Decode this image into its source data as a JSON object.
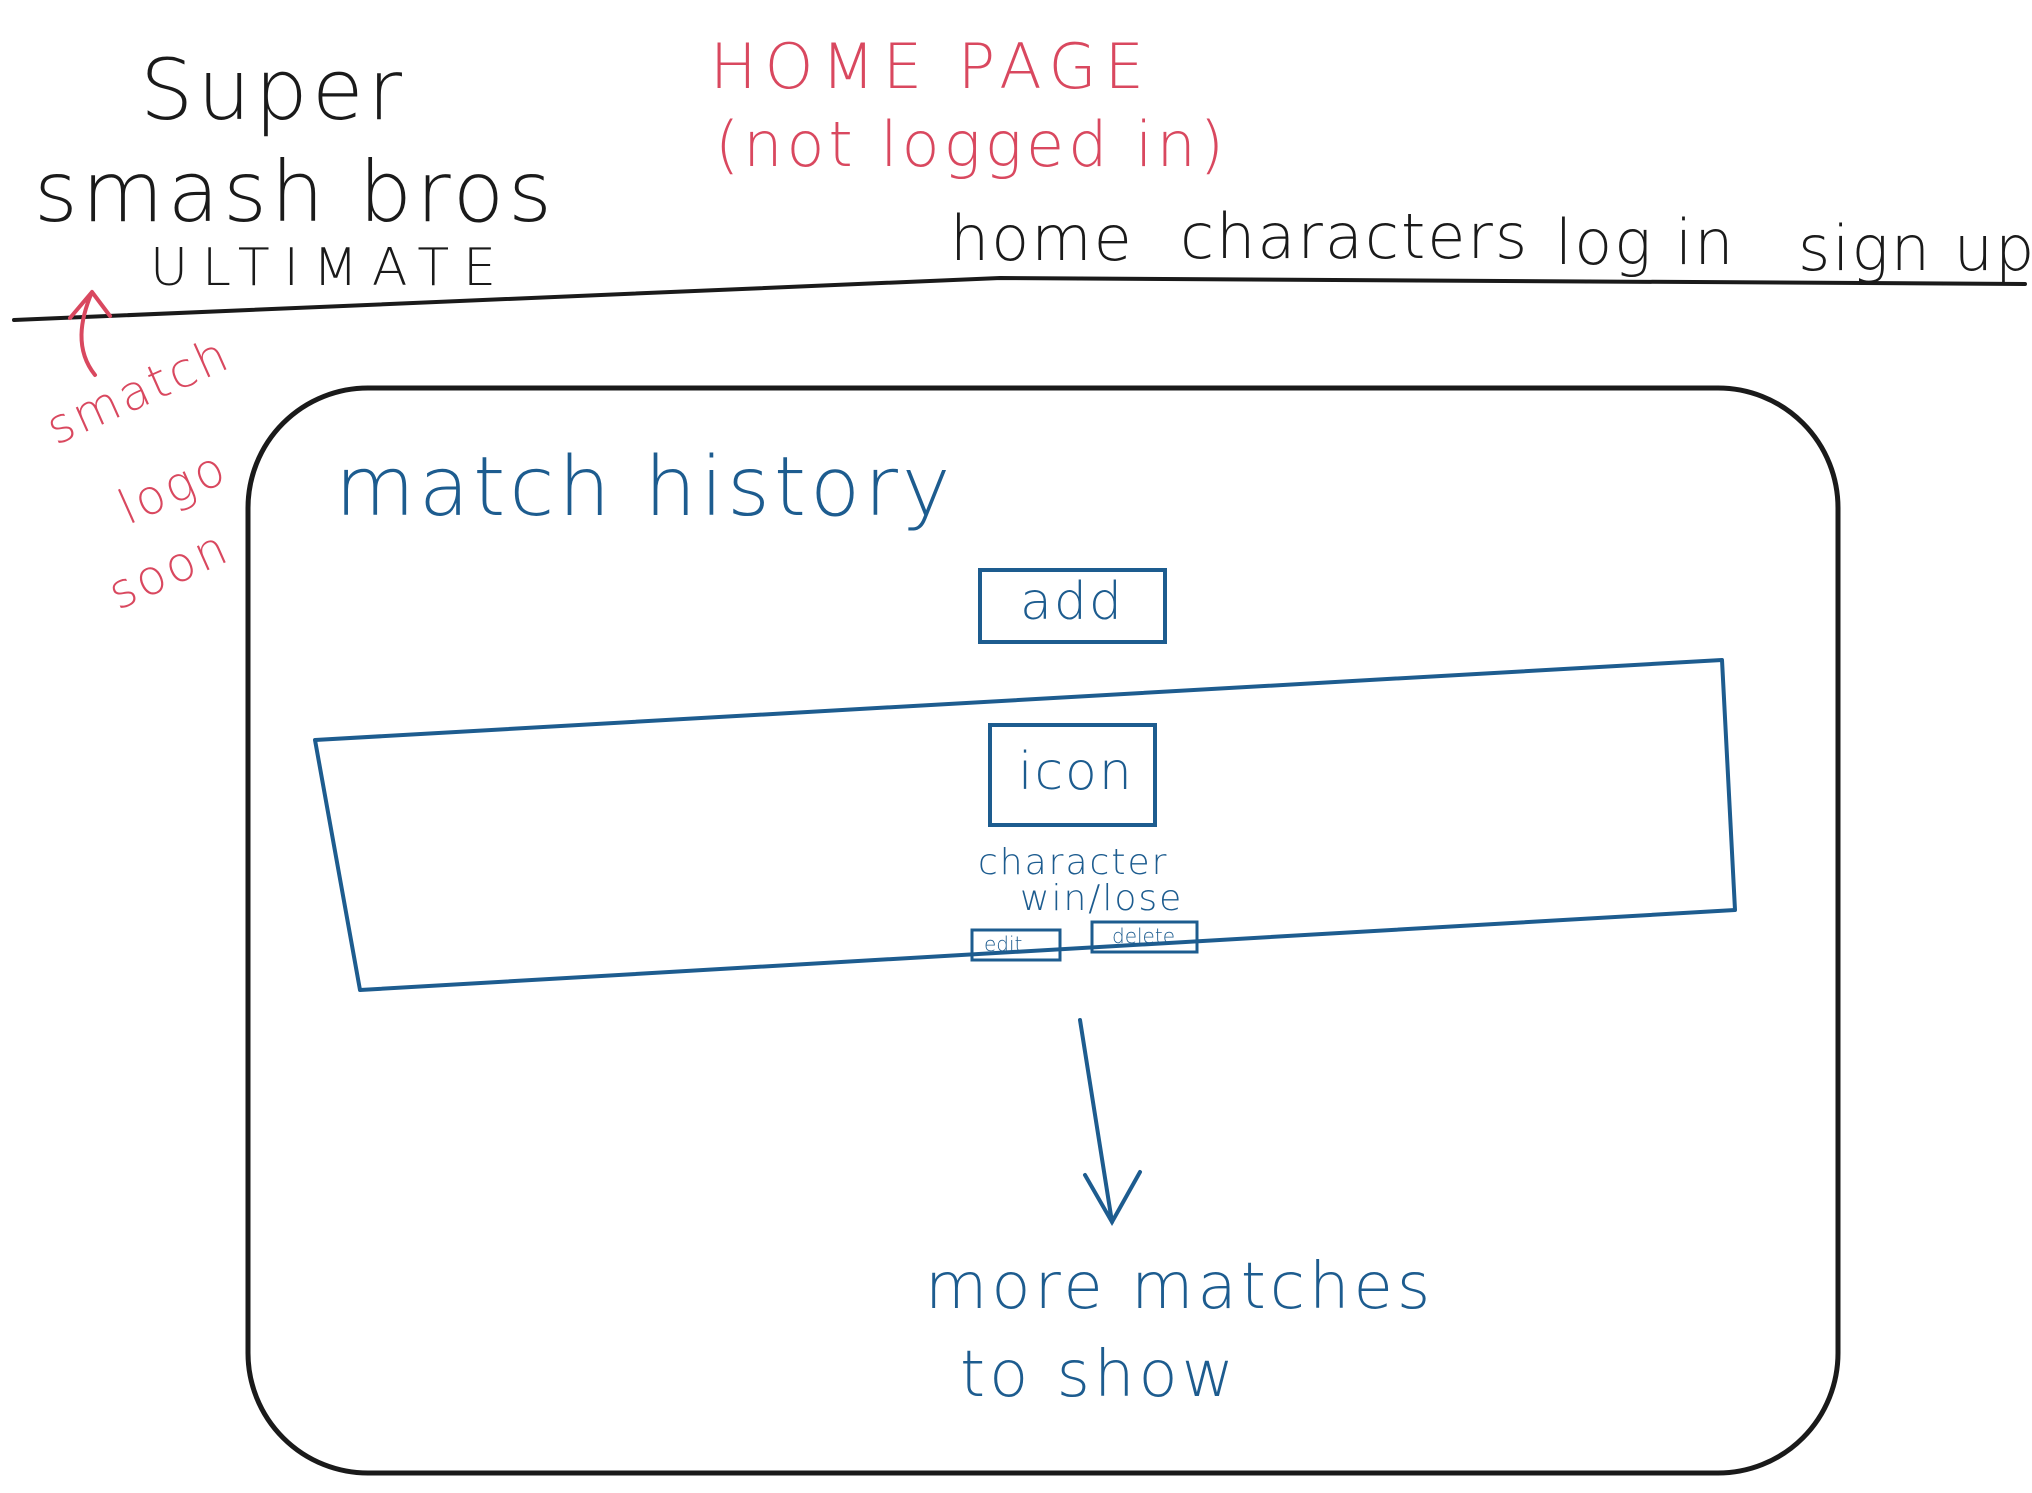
{
  "brand": {
    "line1": "Super",
    "line2": "smash bros",
    "line3": "ULTIMATE"
  },
  "page_note": {
    "line1": "HOME PAGE",
    "line2": "(not logged in)"
  },
  "nav": {
    "home": "home",
    "characters": "characters",
    "login": "log in",
    "signup": "sign up"
  },
  "logo_note": {
    "line1": "smatch",
    "line2": "logo",
    "line3": "soon"
  },
  "main": {
    "heading": "match history",
    "add_label": "add",
    "match_card": {
      "icon_label": "icon",
      "character": "character",
      "result": "win/lose",
      "edit_label": "edit",
      "delete_label": "delete"
    },
    "more_line1": "more matches",
    "more_line2": "to show"
  },
  "colors": {
    "ink": "#1a1a1a",
    "annotation": "#d9485f",
    "content": "#1d5c8f"
  }
}
